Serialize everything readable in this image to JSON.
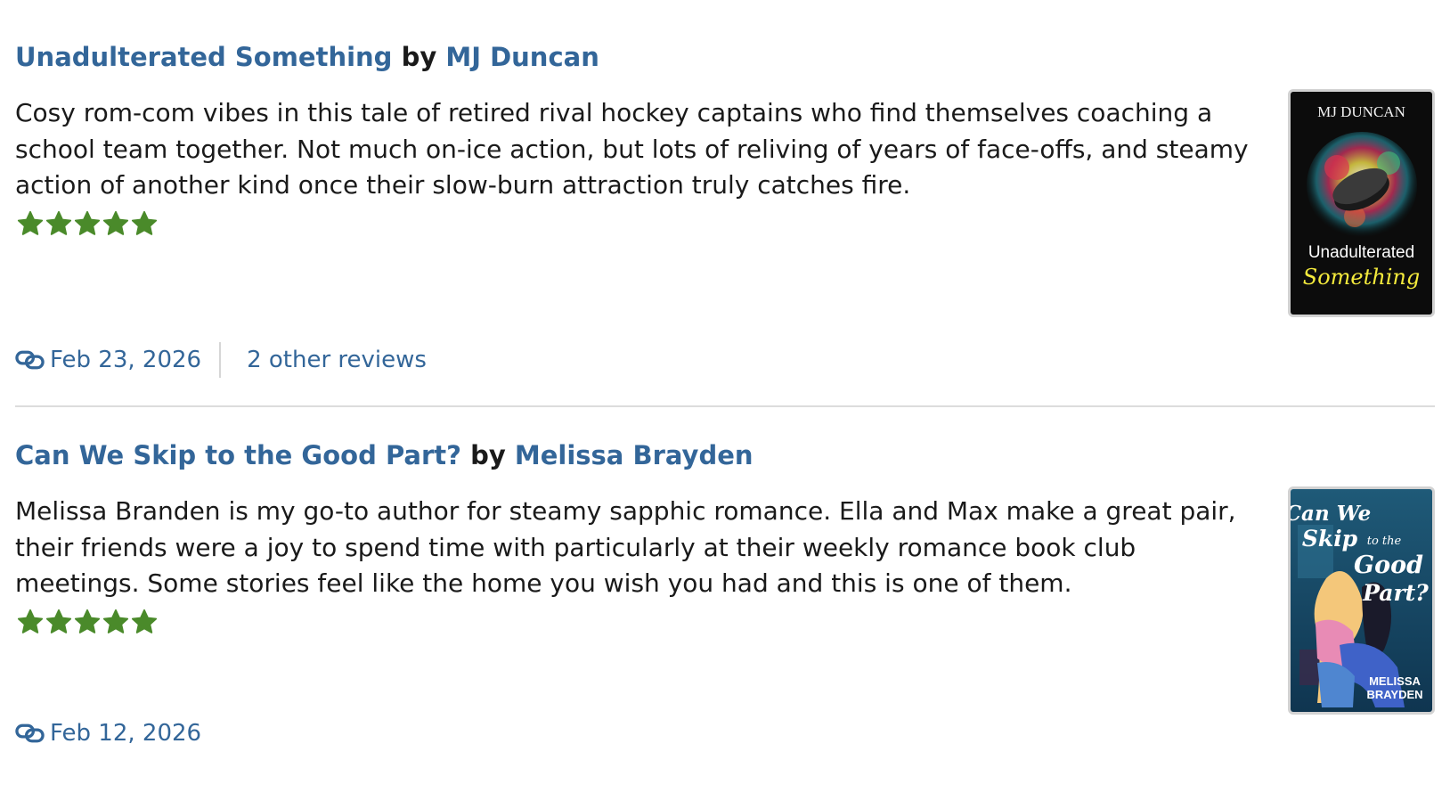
{
  "reviews": [
    {
      "book_title": "Unadulterated Something",
      "by_label": "by",
      "author": "MJ Duncan",
      "text": "Cosy rom-com vibes in this tale of retired rival hockey captains who find themselves coaching a school team together. Not much on-ice action, but lots of reliving of years of face-offs, and steamy action of another kind once their slow-burn attraction truly catches fire.",
      "rating": 5,
      "rating_max": 5,
      "date": "Feb 23, 2026",
      "other_reviews": "2 other reviews",
      "cover": {
        "author_text": "MJ DUNCAN",
        "title_line_1": "Unadulterated",
        "title_line_2": "Something"
      }
    },
    {
      "book_title": "Can We Skip to the Good Part?",
      "by_label": "by",
      "author": "Melissa Brayden",
      "text": "Melissa Branden is my go-to author for steamy sapphic romance. Ella and Max make a great pair, their friends were a joy to spend time with particularly at their weekly romance book club meetings. Some stories feel like the home you wish you had and this is one of them.",
      "rating": 5,
      "rating_max": 5,
      "date": "Feb 12, 2026",
      "cover": {
        "title_line_1": "Can We",
        "title_line_2": "Skip",
        "title_line_3": "to the",
        "title_line_4": "Good",
        "title_line_5": "Part?",
        "author_line_1": "MELISSA",
        "author_line_2": "BRAYDEN"
      }
    }
  ],
  "colors": {
    "link": "#336699",
    "star": "#4a8a2a",
    "divider": "#dcdcdc"
  },
  "icons": {
    "permalink": "link-icon",
    "rating": "star-icon"
  }
}
